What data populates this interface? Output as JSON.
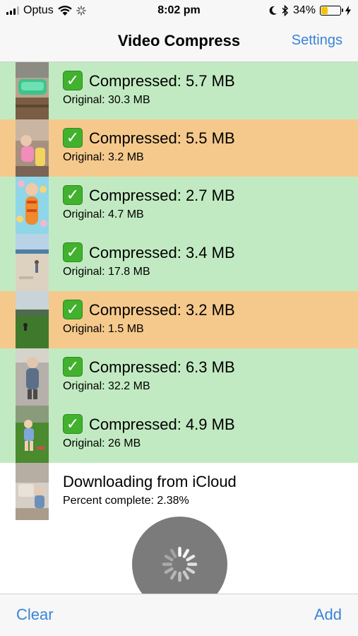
{
  "status_bar": {
    "carrier": "Optus",
    "time": "8:02 pm",
    "battery_percent": "34%",
    "battery_level": 0.34,
    "battery_color": "#f5c400"
  },
  "nav": {
    "title": "Video Compress",
    "settings_label": "Settings"
  },
  "colors": {
    "success_row": "#c2eac2",
    "warning_row": "#f5c98c",
    "accent": "#3a83d6",
    "check": "#41b12e"
  },
  "videos": [
    {
      "status": "success",
      "title": "Compressed: 5.7 MB",
      "subtitle": "Original: 30.3 MB"
    },
    {
      "status": "warning",
      "title": "Compressed: 5.5 MB",
      "subtitle": "Original: 3.2 MB"
    },
    {
      "status": "success",
      "title": "Compressed: 2.7 MB",
      "subtitle": "Original: 4.7 MB"
    },
    {
      "status": "success",
      "title": "Compressed: 3.4 MB",
      "subtitle": "Original: 17.8 MB"
    },
    {
      "status": "warning",
      "title": "Compressed: 3.2 MB",
      "subtitle": "Original: 1.5 MB"
    },
    {
      "status": "success",
      "title": "Compressed: 6.3 MB",
      "subtitle": "Original: 32.2 MB"
    },
    {
      "status": "success",
      "title": "Compressed: 4.9 MB",
      "subtitle": "Original: 26 MB"
    },
    {
      "status": "downloading",
      "title": "Downloading from iCloud",
      "subtitle": "Percent complete: 2.38%"
    }
  ],
  "toolbar": {
    "clear_label": "Clear",
    "add_label": "Add"
  },
  "icons": {
    "signal": "signal-bars-icon",
    "wifi": "wifi-icon",
    "activity": "activity-spinner-icon",
    "moon": "moon-icon",
    "bluetooth": "bluetooth-icon",
    "battery": "battery-icon",
    "charging": "charging-bolt-icon",
    "check": "check-mark-icon",
    "loading": "loading-spinner-icon"
  }
}
